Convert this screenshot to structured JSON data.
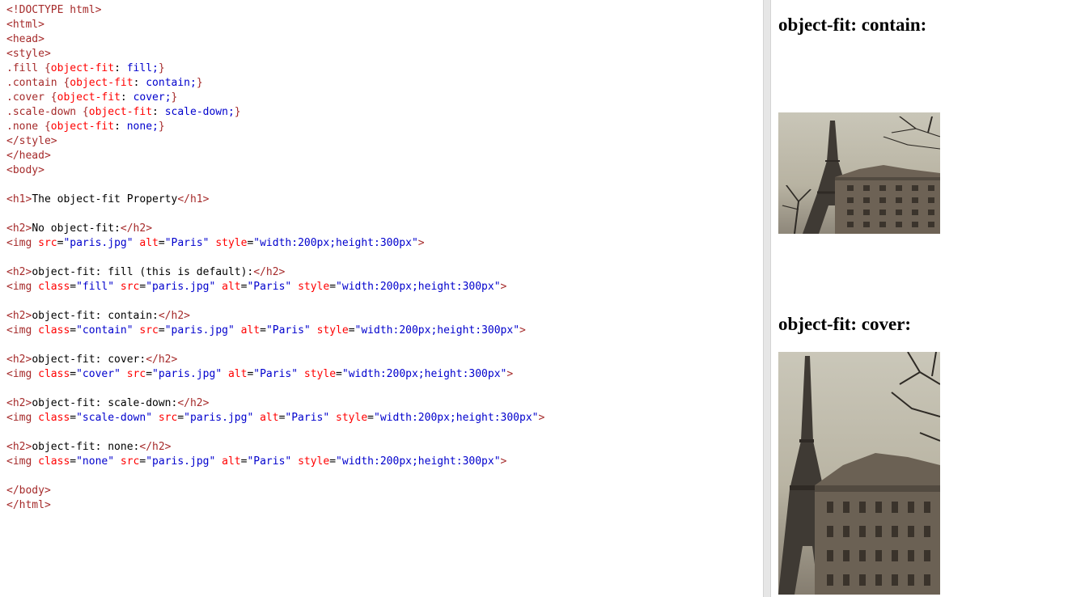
{
  "editor": {
    "lines": [
      {
        "parts": [
          {
            "c": "tag",
            "t": "<!DOCTYPE html>"
          }
        ]
      },
      {
        "parts": [
          {
            "c": "tag",
            "t": "<html>"
          }
        ]
      },
      {
        "parts": [
          {
            "c": "tag",
            "t": "<head>"
          }
        ]
      },
      {
        "parts": [
          {
            "c": "tag",
            "t": "<style>"
          }
        ]
      },
      {
        "parts": [
          {
            "c": "tag",
            "t": ".fill {"
          },
          {
            "c": "attr",
            "t": "object-fit"
          },
          {
            "c": "txt",
            "t": ": "
          },
          {
            "c": "val",
            "t": "fill;"
          },
          {
            "c": "tag",
            "t": "}"
          }
        ]
      },
      {
        "parts": [
          {
            "c": "tag",
            "t": ".contain {"
          },
          {
            "c": "attr",
            "t": "object-fit"
          },
          {
            "c": "txt",
            "t": ": "
          },
          {
            "c": "val",
            "t": "contain;"
          },
          {
            "c": "tag",
            "t": "}"
          }
        ]
      },
      {
        "parts": [
          {
            "c": "tag",
            "t": ".cover {"
          },
          {
            "c": "attr",
            "t": "object-fit"
          },
          {
            "c": "txt",
            "t": ": "
          },
          {
            "c": "val",
            "t": "cover;"
          },
          {
            "c": "tag",
            "t": "}"
          }
        ]
      },
      {
        "parts": [
          {
            "c": "tag",
            "t": ".scale-down {"
          },
          {
            "c": "attr",
            "t": "object-fit"
          },
          {
            "c": "txt",
            "t": ": "
          },
          {
            "c": "val",
            "t": "scale-down;"
          },
          {
            "c": "tag",
            "t": "}"
          }
        ]
      },
      {
        "parts": [
          {
            "c": "tag",
            "t": ".none {"
          },
          {
            "c": "attr",
            "t": "object-fit"
          },
          {
            "c": "txt",
            "t": ": "
          },
          {
            "c": "val",
            "t": "none;"
          },
          {
            "c": "tag",
            "t": "}"
          }
        ]
      },
      {
        "parts": [
          {
            "c": "tag",
            "t": "</style>"
          }
        ]
      },
      {
        "parts": [
          {
            "c": "tag",
            "t": "</head>"
          }
        ]
      },
      {
        "parts": [
          {
            "c": "tag",
            "t": "<body>"
          }
        ]
      },
      {
        "parts": []
      },
      {
        "parts": [
          {
            "c": "tag",
            "t": "<h1>"
          },
          {
            "c": "txt",
            "t": "The object-fit Property"
          },
          {
            "c": "tag",
            "t": "</h1>"
          }
        ]
      },
      {
        "parts": []
      },
      {
        "parts": [
          {
            "c": "tag",
            "t": "<h2>"
          },
          {
            "c": "txt",
            "t": "No object-fit:"
          },
          {
            "c": "tag",
            "t": "</h2>"
          }
        ]
      },
      {
        "parts": [
          {
            "c": "tag",
            "t": "<img "
          },
          {
            "c": "attr",
            "t": "src"
          },
          {
            "c": "txt",
            "t": "="
          },
          {
            "c": "val",
            "t": "\"paris.jpg\""
          },
          {
            "c": "txt",
            "t": " "
          },
          {
            "c": "attr",
            "t": "alt"
          },
          {
            "c": "txt",
            "t": "="
          },
          {
            "c": "val",
            "t": "\"Paris\""
          },
          {
            "c": "txt",
            "t": " "
          },
          {
            "c": "attr",
            "t": "style"
          },
          {
            "c": "txt",
            "t": "="
          },
          {
            "c": "val",
            "t": "\"width:200px;height:300px\""
          },
          {
            "c": "tag",
            "t": ">"
          }
        ]
      },
      {
        "parts": []
      },
      {
        "parts": [
          {
            "c": "tag",
            "t": "<h2>"
          },
          {
            "c": "txt",
            "t": "object-fit: fill (this is default):"
          },
          {
            "c": "tag",
            "t": "</h2>"
          }
        ]
      },
      {
        "parts": [
          {
            "c": "tag",
            "t": "<img "
          },
          {
            "c": "attr",
            "t": "class"
          },
          {
            "c": "txt",
            "t": "="
          },
          {
            "c": "val",
            "t": "\"fill\""
          },
          {
            "c": "txt",
            "t": " "
          },
          {
            "c": "attr",
            "t": "src"
          },
          {
            "c": "txt",
            "t": "="
          },
          {
            "c": "val",
            "t": "\"paris.jpg\""
          },
          {
            "c": "txt",
            "t": " "
          },
          {
            "c": "attr",
            "t": "alt"
          },
          {
            "c": "txt",
            "t": "="
          },
          {
            "c": "val",
            "t": "\"Paris\""
          },
          {
            "c": "txt",
            "t": " "
          },
          {
            "c": "attr",
            "t": "style"
          },
          {
            "c": "txt",
            "t": "="
          },
          {
            "c": "val",
            "t": "\"width:200px;height:300px\""
          },
          {
            "c": "tag",
            "t": ">"
          }
        ]
      },
      {
        "parts": []
      },
      {
        "parts": [
          {
            "c": "tag",
            "t": "<h2>"
          },
          {
            "c": "txt",
            "t": "object-fit: contain:"
          },
          {
            "c": "tag",
            "t": "</h2>"
          }
        ]
      },
      {
        "parts": [
          {
            "c": "tag",
            "t": "<img "
          },
          {
            "c": "attr",
            "t": "class"
          },
          {
            "c": "txt",
            "t": "="
          },
          {
            "c": "val",
            "t": "\"contain\""
          },
          {
            "c": "txt",
            "t": " "
          },
          {
            "c": "attr",
            "t": "src"
          },
          {
            "c": "txt",
            "t": "="
          },
          {
            "c": "val",
            "t": "\"paris.jpg\""
          },
          {
            "c": "txt",
            "t": " "
          },
          {
            "c": "attr",
            "t": "alt"
          },
          {
            "c": "txt",
            "t": "="
          },
          {
            "c": "val",
            "t": "\"Paris\""
          },
          {
            "c": "txt",
            "t": " "
          },
          {
            "c": "attr",
            "t": "style"
          },
          {
            "c": "txt",
            "t": "="
          },
          {
            "c": "val",
            "t": "\"width:200px;height:300px\""
          },
          {
            "c": "tag",
            "t": ">"
          }
        ]
      },
      {
        "parts": []
      },
      {
        "parts": [
          {
            "c": "tag",
            "t": "<h2>"
          },
          {
            "c": "txt",
            "t": "object-fit: cover:"
          },
          {
            "c": "tag",
            "t": "</h2>"
          }
        ]
      },
      {
        "parts": [
          {
            "c": "tag",
            "t": "<img "
          },
          {
            "c": "attr",
            "t": "class"
          },
          {
            "c": "txt",
            "t": "="
          },
          {
            "c": "val",
            "t": "\"cover\""
          },
          {
            "c": "txt",
            "t": " "
          },
          {
            "c": "attr",
            "t": "src"
          },
          {
            "c": "txt",
            "t": "="
          },
          {
            "c": "val",
            "t": "\"paris.jpg\""
          },
          {
            "c": "txt",
            "t": " "
          },
          {
            "c": "attr",
            "t": "alt"
          },
          {
            "c": "txt",
            "t": "="
          },
          {
            "c": "val",
            "t": "\"Paris\""
          },
          {
            "c": "txt",
            "t": " "
          },
          {
            "c": "attr",
            "t": "style"
          },
          {
            "c": "txt",
            "t": "="
          },
          {
            "c": "val",
            "t": "\"width:200px;height:300px\""
          },
          {
            "c": "tag",
            "t": ">"
          }
        ]
      },
      {
        "parts": []
      },
      {
        "parts": [
          {
            "c": "tag",
            "t": "<h2>"
          },
          {
            "c": "txt",
            "t": "object-fit: scale-down:"
          },
          {
            "c": "tag",
            "t": "</h2>"
          }
        ]
      },
      {
        "parts": [
          {
            "c": "tag",
            "t": "<img "
          },
          {
            "c": "attr",
            "t": "class"
          },
          {
            "c": "txt",
            "t": "="
          },
          {
            "c": "val",
            "t": "\"scale-down\""
          },
          {
            "c": "txt",
            "t": " "
          },
          {
            "c": "attr",
            "t": "src"
          },
          {
            "c": "txt",
            "t": "="
          },
          {
            "c": "val",
            "t": "\"paris.jpg\""
          },
          {
            "c": "txt",
            "t": " "
          },
          {
            "c": "attr",
            "t": "alt"
          },
          {
            "c": "txt",
            "t": "="
          },
          {
            "c": "val",
            "t": "\"Paris\""
          },
          {
            "c": "txt",
            "t": " "
          },
          {
            "c": "attr",
            "t": "style"
          },
          {
            "c": "txt",
            "t": "="
          },
          {
            "c": "val",
            "t": "\"width:200px;height:300px\""
          },
          {
            "c": "tag",
            "t": ">"
          }
        ]
      },
      {
        "parts": []
      },
      {
        "parts": [
          {
            "c": "tag",
            "t": "<h2>"
          },
          {
            "c": "txt",
            "t": "object-fit: none:"
          },
          {
            "c": "tag",
            "t": "</h2>"
          }
        ]
      },
      {
        "parts": [
          {
            "c": "tag",
            "t": "<img "
          },
          {
            "c": "attr",
            "t": "class"
          },
          {
            "c": "txt",
            "t": "="
          },
          {
            "c": "val",
            "t": "\"none\""
          },
          {
            "c": "txt",
            "t": " "
          },
          {
            "c": "attr",
            "t": "src"
          },
          {
            "c": "txt",
            "t": "="
          },
          {
            "c": "val",
            "t": "\"paris.jpg\""
          },
          {
            "c": "txt",
            "t": " "
          },
          {
            "c": "attr",
            "t": "alt"
          },
          {
            "c": "txt",
            "t": "="
          },
          {
            "c": "val",
            "t": "\"Paris\""
          },
          {
            "c": "txt",
            "t": " "
          },
          {
            "c": "attr",
            "t": "style"
          },
          {
            "c": "txt",
            "t": "="
          },
          {
            "c": "val",
            "t": "\"width:200px;height:300px\""
          },
          {
            "c": "tag",
            "t": ">"
          }
        ]
      },
      {
        "parts": []
      },
      {
        "parts": [
          {
            "c": "tag",
            "t": "</body>"
          }
        ]
      },
      {
        "parts": [
          {
            "c": "tag",
            "t": "</html>"
          }
        ]
      }
    ]
  },
  "result": {
    "heading_contain": "object-fit: contain:",
    "heading_cover": "object-fit: cover:",
    "image_alt": "Paris"
  },
  "colors": {
    "tag": "#a52a2a",
    "attribute": "#ff0000",
    "value": "#0000cd",
    "divider": "#e6e6e6"
  }
}
